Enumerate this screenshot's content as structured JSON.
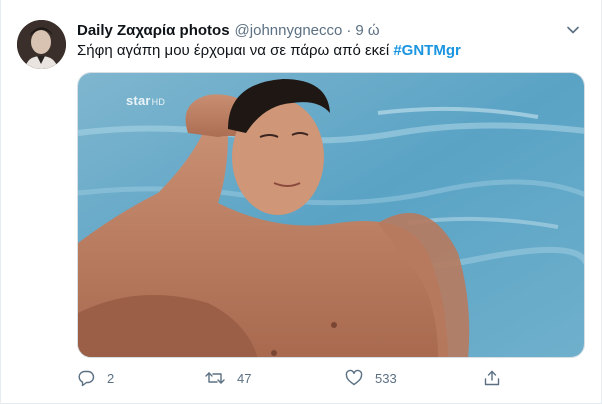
{
  "tweet": {
    "display_name": "Daily Ζαχαρία photos",
    "handle": "@johnnygnecco",
    "separator": "·",
    "time": "9 ώ",
    "text": "Σήφη αγάπη μου έρχομαι να σε πάρω από εκεί ",
    "hashtag": "#GNTMgr",
    "media_watermark": "star",
    "media_watermark_suffix": "HD",
    "stats": {
      "replies": "2",
      "retweets": "47",
      "likes": "533"
    }
  },
  "colors": {
    "accent": "#1b95e0",
    "muted": "#5b7083",
    "border": "#e6ecf0"
  },
  "icons": [
    "more-chevron-icon",
    "reply-icon",
    "retweet-icon",
    "like-icon",
    "share-icon"
  ]
}
